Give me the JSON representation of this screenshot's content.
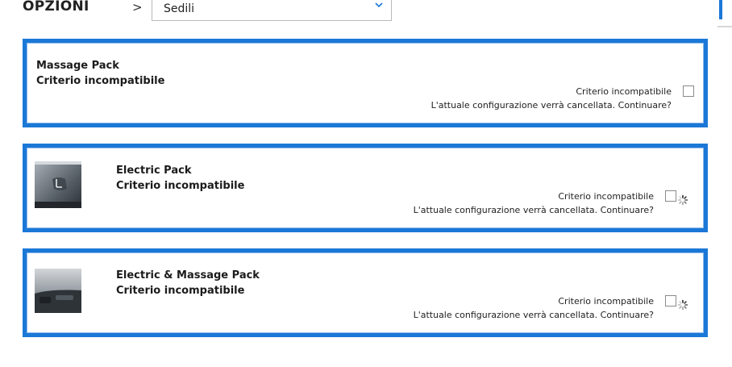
{
  "header": {
    "title": "OPZIONI",
    "separator": ">",
    "select": {
      "value": "Sedili",
      "icon": "chevron-down-icon"
    }
  },
  "options": [
    {
      "name": "Massage Pack",
      "status": "Criterio incompatibile",
      "note_line1": "Criterio incompatibile",
      "note_line2": "L'attuale configurazione verrà cancellata. Continuare?",
      "has_image": false,
      "loading": false
    },
    {
      "name": "Electric Pack",
      "status": "Criterio incompatibile",
      "note_line1": "Criterio incompatibile",
      "note_line2": "L'attuale configurazione verrà cancellata. Continuare?",
      "has_image": true,
      "loading": true
    },
    {
      "name": "Electric & Massage Pack",
      "status": "Criterio incompatibile",
      "note_line1": "Criterio incompatibile",
      "note_line2": "L'attuale configurazione verrà cancellata. Continuare?",
      "has_image": true,
      "loading": true
    }
  ],
  "colors": {
    "accent": "#1b78d7",
    "text": "#1b1b1b",
    "border": "#b9b9b9"
  }
}
